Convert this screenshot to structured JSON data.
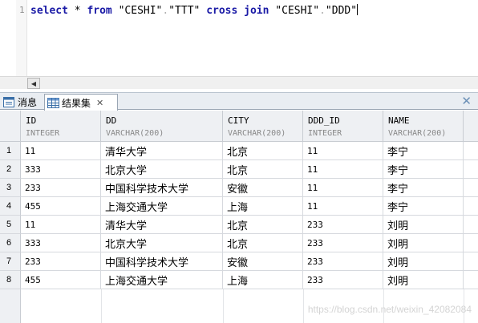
{
  "editor": {
    "line_number": "1",
    "tokens": {
      "select": "select",
      "star": " * ",
      "from": "from",
      "schema1": " \"CESHI\"",
      "dot1": ".",
      "table1": "\"TTT\" ",
      "cross": "cross",
      "sp": " ",
      "join": "join",
      "schema2": " \"CESHI\"",
      "dot2": ".",
      "table2": "\"DDD\""
    }
  },
  "tabs": {
    "messages": "消息",
    "results": "结果集"
  },
  "grid": {
    "columns": [
      {
        "name": "ID",
        "type": "INTEGER"
      },
      {
        "name": "DD",
        "type": "VARCHAR(200)"
      },
      {
        "name": "CITY",
        "type": "VARCHAR(200)"
      },
      {
        "name": "DDD_ID",
        "type": "INTEGER"
      },
      {
        "name": "NAME",
        "type": "VARCHAR(200)"
      }
    ],
    "rows": [
      {
        "n": "1",
        "c": [
          "11",
          "清华大学",
          "北京",
          "11",
          "李宁"
        ]
      },
      {
        "n": "2",
        "c": [
          "333",
          "北京大学",
          "北京",
          "11",
          "李宁"
        ]
      },
      {
        "n": "3",
        "c": [
          "233",
          "中国科学技术大学",
          "安徽",
          "11",
          "李宁"
        ]
      },
      {
        "n": "4",
        "c": [
          "455",
          "上海交通大学",
          "上海",
          "11",
          "李宁"
        ]
      },
      {
        "n": "5",
        "c": [
          "11",
          "清华大学",
          "北京",
          "233",
          "刘明"
        ]
      },
      {
        "n": "6",
        "c": [
          "333",
          "北京大学",
          "北京",
          "233",
          "刘明"
        ]
      },
      {
        "n": "7",
        "c": [
          "233",
          "中国科学技术大学",
          "安徽",
          "233",
          "刘明"
        ]
      },
      {
        "n": "8",
        "c": [
          "455",
          "上海交通大学",
          "上海",
          "233",
          "刘明"
        ]
      }
    ]
  },
  "watermark": "https://blog.csdn.net/weixin_42082084",
  "icons": {
    "messages_tab": "message-icon",
    "results_tab": "grid-table-icon",
    "close": "close-icon",
    "scroll_left": "scroll-left-arrow-icon"
  },
  "colors": {
    "keyword": "#1a1aa6",
    "header_bg": "#eef0f3",
    "tabbar_bg": "#e9edf2"
  }
}
